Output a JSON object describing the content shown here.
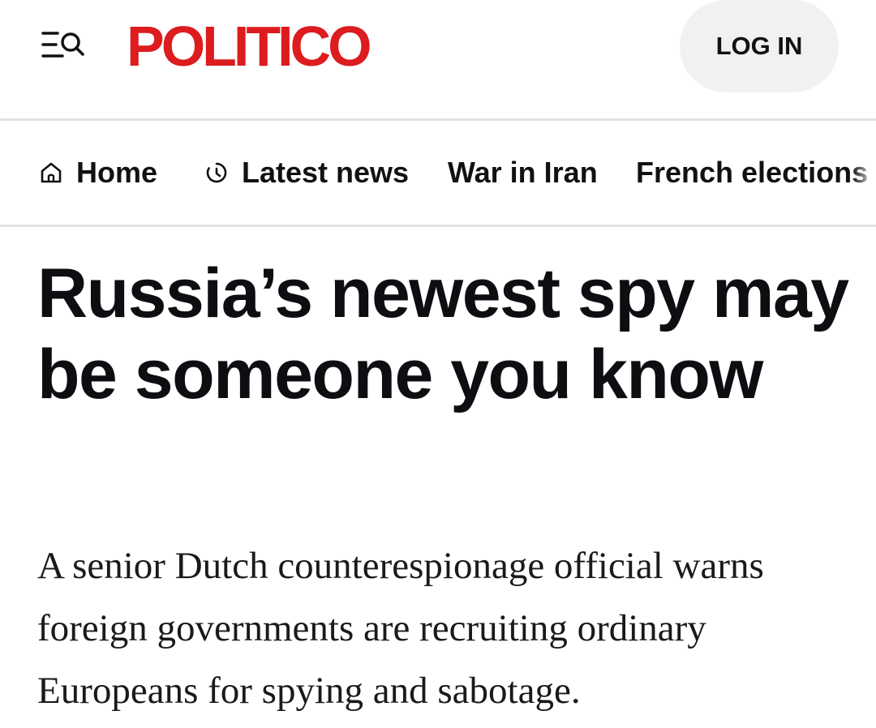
{
  "header": {
    "brand": "POLITICO",
    "brand_color": "#dc1c1f",
    "menu_icon": "menu-search-icon",
    "login_label": "LOG IN"
  },
  "nav": {
    "items": [
      {
        "label": "Home",
        "icon": "home-icon"
      },
      {
        "label": "Latest news",
        "icon": "clock-icon"
      },
      {
        "label": "War in Iran"
      },
      {
        "label": "French elections"
      }
    ]
  },
  "article": {
    "headline": "Russia’s newest spy may be someone you know",
    "dek": "A senior Dutch counterespionage official warns foreign governments are recruiting ordinary Europeans for spying and sabotage."
  }
}
